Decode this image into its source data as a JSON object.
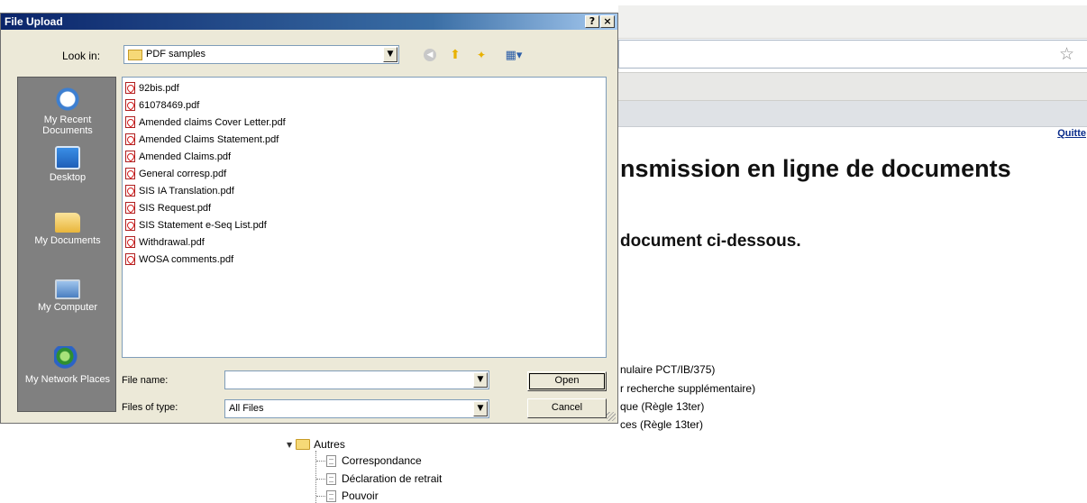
{
  "dialog": {
    "title": "File Upload",
    "help_label": "?",
    "close_label": "×",
    "look_in_label": "Look in:",
    "look_in_value": "PDF samples",
    "places": [
      "My Recent Documents",
      "Desktop",
      "My Documents",
      "My Computer",
      "My Network Places"
    ],
    "files": [
      "92bis.pdf",
      "61078469.pdf",
      "Amended claims Cover Letter.pdf",
      "Amended Claims Statement.pdf",
      "Amended Claims.pdf",
      "General corresp.pdf",
      "SIS IA Translation.pdf",
      "SIS Request.pdf",
      "SIS Statement e-Seq List.pdf",
      "Withdrawal.pdf",
      "WOSA comments.pdf"
    ],
    "file_name_label": "File name:",
    "file_name_value": "",
    "files_of_type_label": "Files of type:",
    "files_of_type_value": "All Files",
    "open_label": "Open",
    "cancel_label": "Cancel"
  },
  "background": {
    "quit_link": "Quitte",
    "heading": "nsmission en ligne de documents",
    "subheading": "document ci-dessous.",
    "options": [
      "nulaire PCT/IB/375)",
      "r recherche supplémentaire)",
      "que (Règle 13ter)",
      "ces (Règle 13ter)"
    ],
    "tree": {
      "folder": "Autres",
      "items": [
        "Correspondance",
        "Déclaration de retrait",
        "Pouvoir"
      ]
    }
  },
  "colors": {
    "title_gradient_start": "#0a246a",
    "dialog_face": "#ece9d8",
    "places_bar": "#808080"
  },
  "icons": {
    "back": "back-arrow-icon",
    "up": "up-folder-icon",
    "new_folder": "new-folder-icon",
    "views": "views-menu-icon",
    "star": "bookmark-star-icon"
  }
}
